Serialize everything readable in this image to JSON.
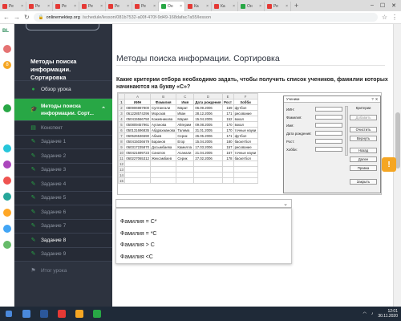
{
  "browser": {
    "tabs": [
      {
        "label": "Ре",
        "color": "#e53935"
      },
      {
        "label": "Ре",
        "color": "#e53935"
      },
      {
        "label": "Ре",
        "color": "#e53935"
      },
      {
        "label": "Ре",
        "color": "#e53935"
      },
      {
        "label": "Ре",
        "color": "#e53935"
      },
      {
        "label": "Ре",
        "color": "#e53935"
      },
      {
        "label": "Он",
        "color": "#28a745",
        "active": true
      },
      {
        "label": "Ка",
        "color": "#e53935"
      },
      {
        "label": "Ка",
        "color": "#e53935"
      },
      {
        "label": "Он",
        "color": "#28a745"
      },
      {
        "label": "Ре",
        "color": "#e53935"
      }
    ],
    "new_tab": "+",
    "url_host": "onlinemektep.org",
    "url_path": "/schedule/lesson/081b7532-a00f-470f-9d49-168dafac7a55/lesson"
  },
  "thinbar": {
    "logo": "BL",
    "badge": "8"
  },
  "sidebar": {
    "course_title": "Методы поиска информации. Сортировка",
    "overview": "Обзор урока",
    "current": "Методы поиска информации. Сорт...",
    "items": [
      "Конспект",
      "Задание 1",
      "Задание 2",
      "Задание 3",
      "Задание 4",
      "Задание 5",
      "Задание 6",
      "Задание 7",
      "Задание 8",
      "Задание 9"
    ],
    "final": "Итог урока"
  },
  "main": {
    "title": "Методы поиска информации. Сортировка",
    "question": "Какие критерии отбора необходимо задать, чтобы получить список учеников, фамилии которых начинаются на букву «С»?"
  },
  "sheet": {
    "col_letters": [
      "",
      "A",
      "B",
      "C",
      "D",
      "E",
      "F"
    ],
    "header": [
      "ИИН",
      "Фамилия",
      "Имя",
      "Дата рождения",
      "Рост",
      "Хобби"
    ],
    "rows": [
      [
        "080906987800",
        "Султангали",
        "Марат",
        "06.09.2006",
        "169",
        "футбол"
      ],
      [
        "061228574296",
        "Морозов",
        "Иван",
        "28.12.2006",
        "171",
        "рисование"
      ],
      [
        "050415566750",
        "Кожевникова",
        "Мария",
        "15.04.2005",
        "152",
        "вокал"
      ],
      [
        "050809457961",
        "Ауганова",
        "Айгерим",
        "09.08.2005",
        "170",
        "вокал"
      ],
      [
        "050131696835",
        "Абдрахманова",
        "Талима",
        "31.01.2005",
        "170",
        "точные науки"
      ],
      [
        "060526536590",
        "Абаев",
        "Серик",
        "26.05.2006",
        "171",
        "футбол"
      ],
      [
        "050415036679",
        "Баранов",
        "Егор",
        "15.04.2005",
        "180",
        "баскетбол"
      ],
      [
        "060317235870",
        "Досымбаева",
        "Камилла",
        "17.03.2006",
        "157",
        "рисование"
      ],
      [
        "050421699723",
        "Санатов",
        "Асанали",
        "21.04.2005",
        "167",
        "точные науки"
      ],
      [
        "060227065312",
        "Жексамбаев",
        "Серик",
        "27.02.2006",
        "178",
        "баскетбол"
      ]
    ]
  },
  "form": {
    "title": "Ученики",
    "help": "?",
    "close": "X",
    "fields": [
      "ИИН:",
      "Фамилия:",
      "Имя:",
      "Дата рождения:",
      "Рост:",
      "Хобби:"
    ],
    "buttons": [
      "Критерии",
      "Добавить",
      "Очистить",
      "Вернуть",
      "Назад",
      "Далее",
      "Правка",
      "Закрыть"
    ]
  },
  "select": {
    "options": [
      "Фамилия = С*",
      "Фамилия = *С",
      "Фамилия > С",
      "Фамилия <С"
    ]
  },
  "taskbar": {
    "time": "12:01",
    "date": "30.11.2020",
    "apps": [
      {
        "color": "#4a89dc"
      },
      {
        "color": "#2b579a"
      },
      {
        "color": "#e53935"
      },
      {
        "color": "#f5a623"
      },
      {
        "color": "#28a745"
      }
    ]
  }
}
